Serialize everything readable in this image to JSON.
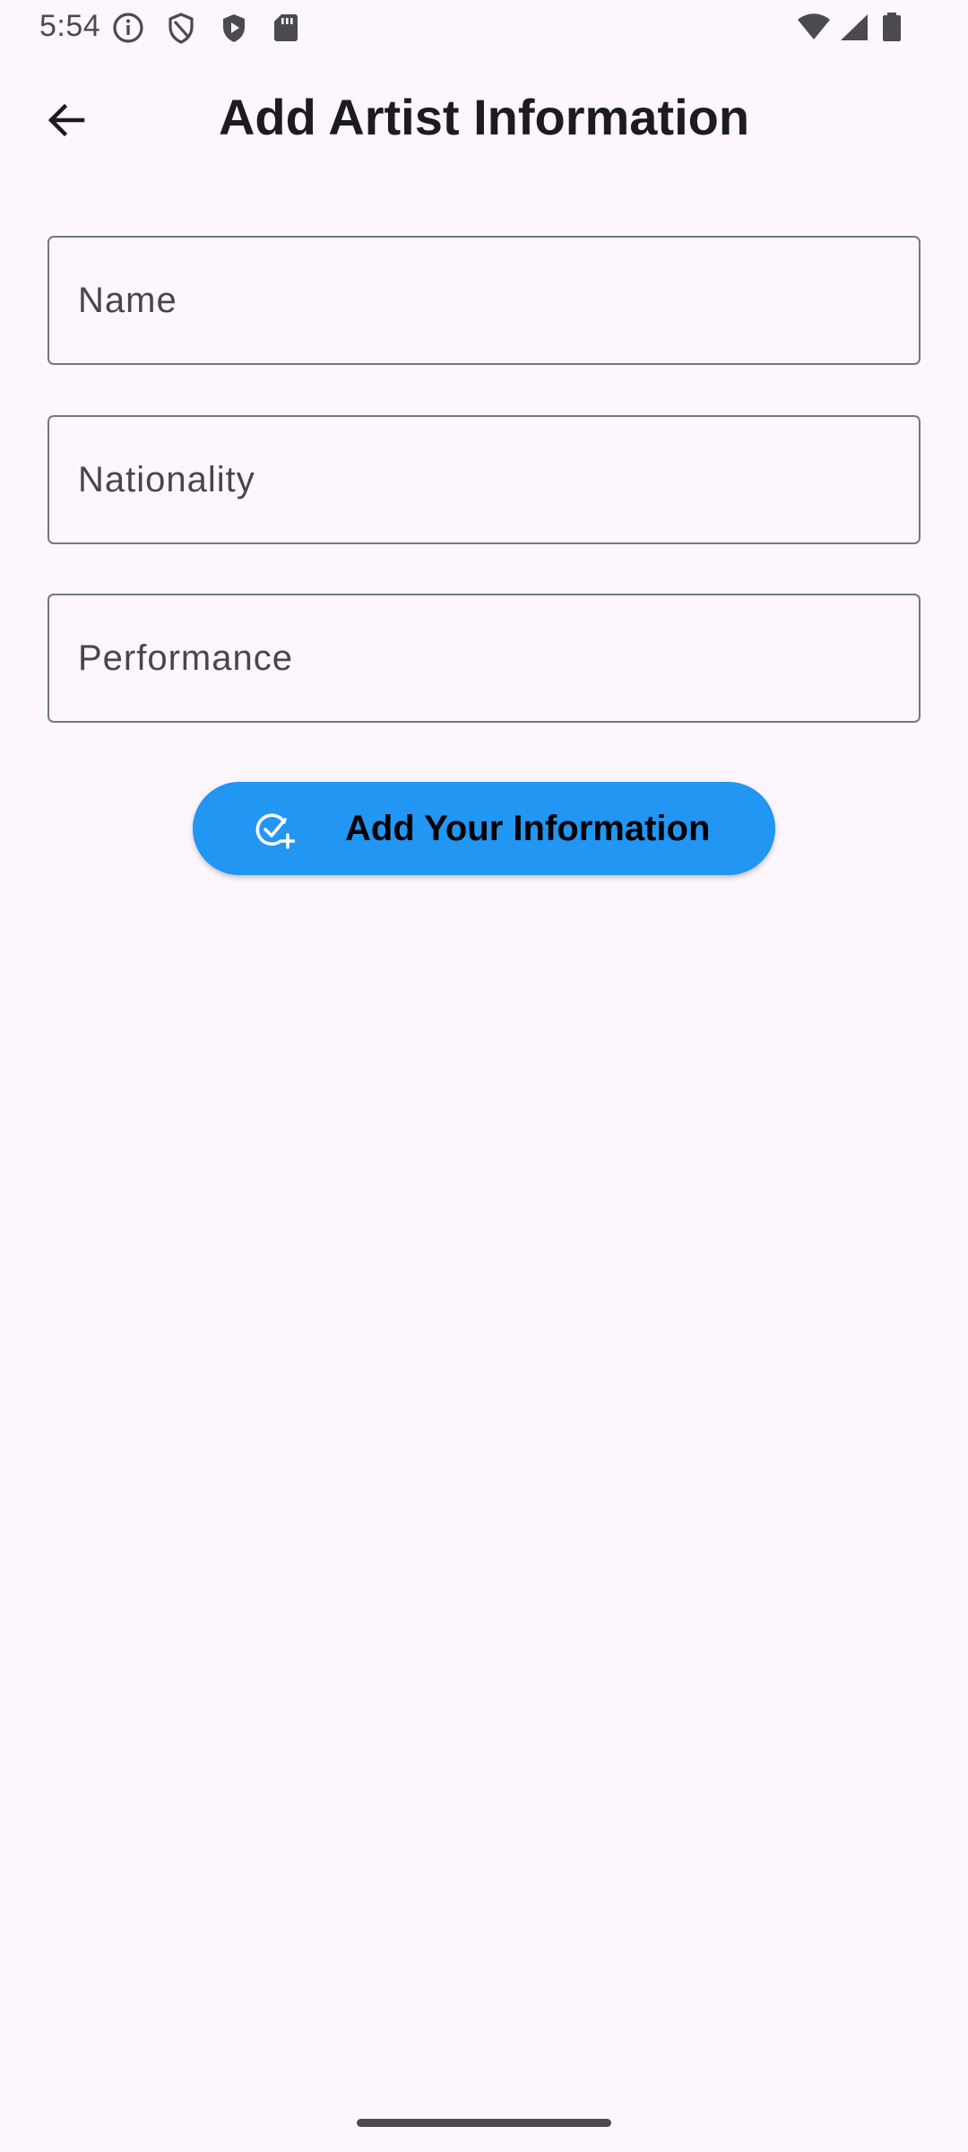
{
  "status_bar": {
    "time": "5:54",
    "icons": [
      "info-icon",
      "shield-outline-icon",
      "shield-play-icon",
      "sd-card-icon",
      "wifi-icon",
      "signal-icon",
      "battery-icon"
    ]
  },
  "app_bar": {
    "back_icon": "arrow-back-icon",
    "title": "Add Artist Information"
  },
  "form": {
    "name": {
      "placeholder": "Name",
      "value": ""
    },
    "nationality": {
      "placeholder": "Nationality",
      "value": ""
    },
    "performance": {
      "placeholder": "Performance",
      "value": ""
    }
  },
  "submit_button": {
    "icon": "check-circle-add-icon",
    "label": "Add Your Information"
  },
  "colors": {
    "background": "#fdf7fd",
    "primary": "#2196f3",
    "field_border": "#79747e",
    "placeholder": "#49454f"
  }
}
